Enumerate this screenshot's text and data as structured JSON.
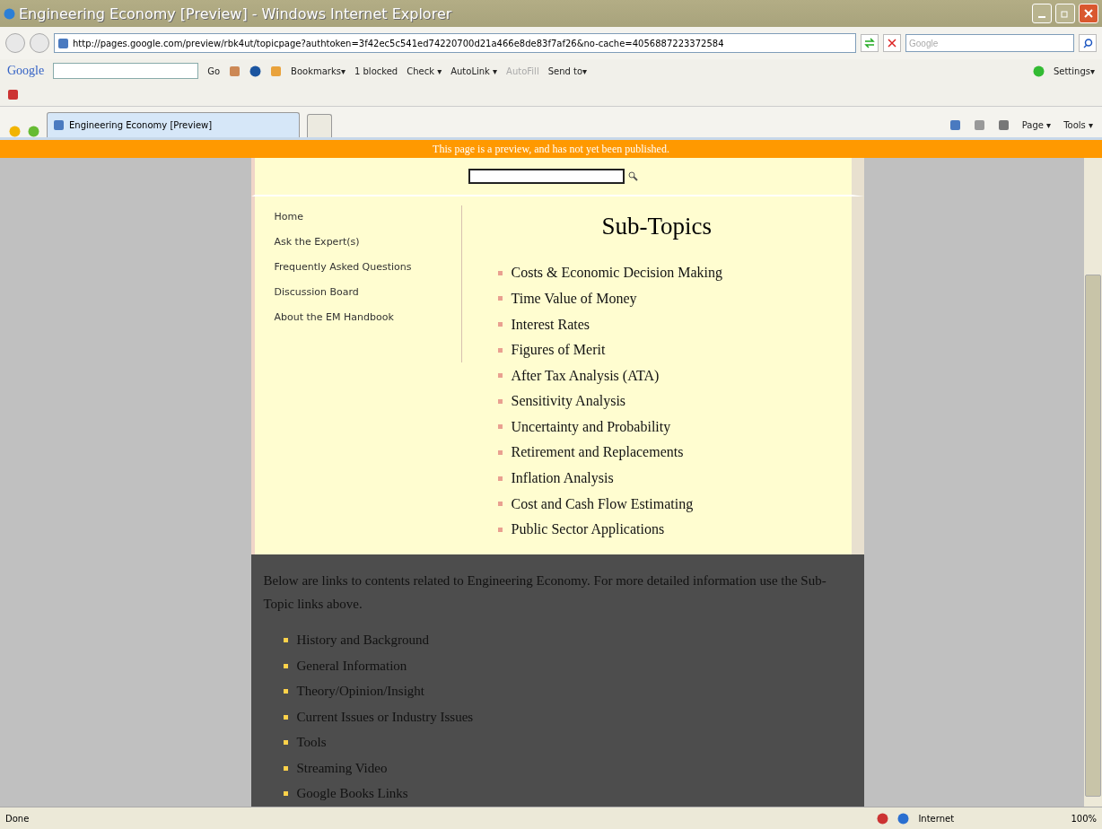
{
  "window": {
    "title": "Engineering Economy [Preview] - Windows Internet Explorer"
  },
  "address": {
    "url": "http://pages.google.com/preview/rbk4ut/topicpage?authtoken=3f42ec5c541ed74220700d21a466e8de83f7af26&no-cache=4056887223372584"
  },
  "search": {
    "placeholder": "Google"
  },
  "google_toolbar": {
    "logo": "Google",
    "go": "Go",
    "items": [
      {
        "label": "Bookmarks▾",
        "disabled": false
      },
      {
        "label": "1 blocked",
        "disabled": false
      },
      {
        "label": "Check ▾",
        "disabled": false
      },
      {
        "label": "AutoLink ▾",
        "disabled": false
      },
      {
        "label": "AutoFill",
        "disabled": true
      },
      {
        "label": "Send to▾",
        "disabled": false
      }
    ],
    "settings": "Settings▾"
  },
  "tabs": [
    {
      "label": "Engineering Economy [Preview]",
      "selected": true
    },
    {
      "selected": false
    }
  ],
  "command_bar": [
    {
      "label": "Page ▾"
    },
    {
      "label": "Tools ▾"
    }
  ],
  "banner": "This page is a preview, and has not yet been published.",
  "nav": [
    "Home",
    "Ask the Expert(s)",
    "Frequently Asked Questions",
    "Discussion Board",
    "About the EM Handbook"
  ],
  "subtopics": {
    "heading": "Sub-Topics",
    "items": [
      "Costs & Economic Decision Making",
      "Time Value of Money",
      "Interest Rates",
      "Figures of Merit",
      "After Tax Analysis (ATA)",
      "Sensitivity Analysis",
      "Uncertainty and Probability",
      "Retirement and Replacements",
      "Inflation Analysis",
      "Cost and Cash Flow Estimating",
      "Public Sector Applications"
    ]
  },
  "contents": {
    "intro": "Below are links to contents related to Engineering Economy.  For more detailed information use the Sub-Topic links above.",
    "links": [
      "History and Background",
      "General Information",
      "Theory/Opinion/Insight",
      "Current Issues or Industry Issues",
      "Tools",
      "Streaming Video",
      "Google Books Links"
    ]
  },
  "status_bar": {
    "text": "Done",
    "zone": "Internet",
    "zoom": "100%"
  }
}
